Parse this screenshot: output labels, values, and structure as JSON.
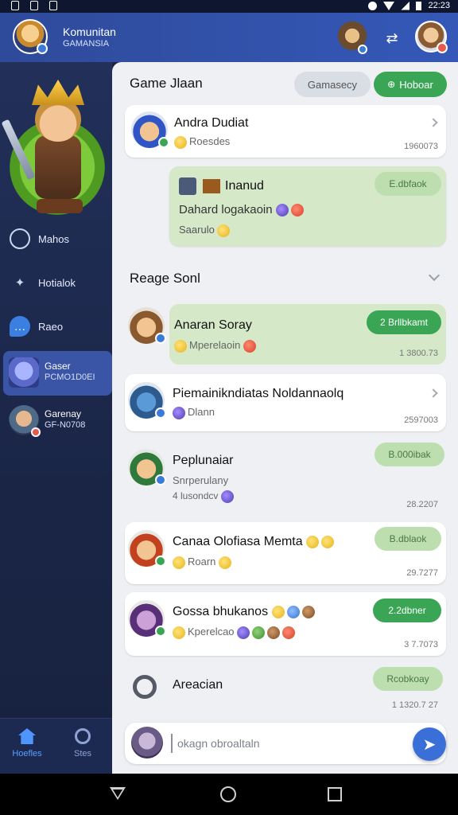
{
  "status_bar": {
    "time": "22:23"
  },
  "header": {
    "title": "Komunitan",
    "subtitle": "GAMANSIA"
  },
  "sidebar": {
    "items": [
      {
        "label": "Mahos",
        "icon": "gear-icon"
      },
      {
        "label": "Hotialok",
        "icon": "gamepad-icon"
      },
      {
        "label": "Raeo",
        "icon": "chat-bubble-icon"
      }
    ],
    "chats": [
      {
        "name": "Gaser",
        "sub": "PCMO1D0EI"
      },
      {
        "name": "Garenay",
        "sub": "GF-N0708"
      }
    ],
    "bottom_nav": [
      {
        "label": "Hoefles",
        "icon": "home-icon"
      },
      {
        "label": "Stes",
        "icon": "gear-icon"
      }
    ]
  },
  "main": {
    "section1_title": "Game Jlaan",
    "filter_pill": "Gamasecy",
    "new_pill": "Hoboar",
    "section2_title": "Reage Sonl",
    "cards": [
      {
        "name": "Andra Dudiat",
        "sub": "Roesdes",
        "meta": "1960073"
      },
      {
        "name": "Inanud",
        "body": "Dahard logakaoin",
        "sub": "Saarulo",
        "button": "E.dbfaok"
      },
      {
        "name": "Anaran Soray",
        "sub": "Mperelaoin",
        "meta": "1 3800.73",
        "button": "2 Brllbkamt"
      },
      {
        "name": "Piemainikndiatas Noldannaolq",
        "sub": "Dlann",
        "meta": "2597003"
      },
      {
        "name": "Peplunaiar",
        "sub": "Snrperulany",
        "sub2": "4 lusondcv",
        "meta": "28.2207",
        "button": "B.000ibak"
      },
      {
        "name": "Canaa Olofiasa Memta",
        "sub": "Roarn",
        "meta": "29.7277",
        "button": "B.dblaok"
      },
      {
        "name": "Gossa bhukanos",
        "sub": "Kperelcao",
        "meta": "3 7.7073",
        "button": "2.2dbner"
      },
      {
        "name": "Areacian",
        "meta": "1 1320.7 27",
        "button": "Rcobkoay"
      }
    ],
    "composer_placeholder": "okagn obroaltaln"
  },
  "colors": {
    "accent_green": "#3aa655",
    "header_blue": "#3558b8",
    "send_blue": "#3a6fd8"
  }
}
